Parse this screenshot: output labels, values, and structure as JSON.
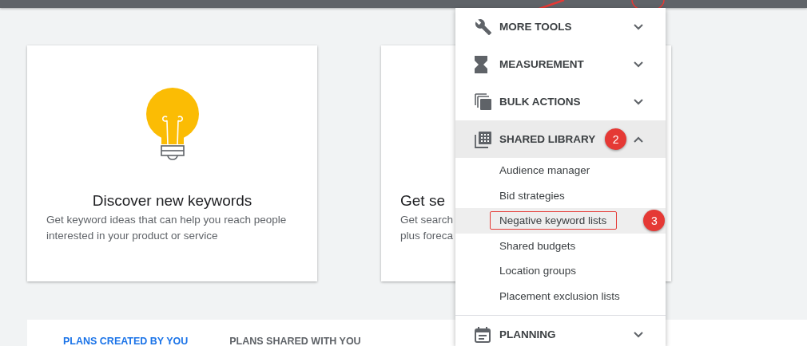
{
  "cards": [
    {
      "kind": "bulb",
      "title": "Discover new keywords",
      "description": [
        "Get keyword ideas that can help you reach people",
        "interested in your product or service"
      ]
    },
    {
      "kind": "plain",
      "title": "Get se",
      "description": [
        "Get search",
        "plus foreca"
      ]
    }
  ],
  "plan_tabs": [
    {
      "label": "PLANS CREATED BY YOU",
      "selected": true
    },
    {
      "label": "PLANS SHARED WITH YOU",
      "selected": false
    }
  ],
  "menu": {
    "sections": [
      {
        "kind": "wrench",
        "label": "MORE TOOLS",
        "expanded": false
      },
      {
        "kind": "hourglass",
        "label": "MEASUREMENT",
        "expanded": false
      },
      {
        "kind": "copies",
        "label": "BULK ACTIONS",
        "expanded": false
      },
      {
        "kind": "library",
        "label": "SHARED LIBRARY",
        "expanded": true,
        "step": "2",
        "items": [
          {
            "label": "Audience manager",
            "selected": false
          },
          {
            "label": "Bid strategies",
            "selected": false
          },
          {
            "label": "Negative keyword lists",
            "selected": true,
            "step": "3"
          },
          {
            "label": "Shared budgets",
            "selected": false
          },
          {
            "label": "Location groups",
            "selected": false
          },
          {
            "label": "Placement exclusion lists",
            "selected": false
          }
        ]
      },
      {
        "kind": "calendar",
        "label": "PLANNING",
        "expanded": false
      }
    ]
  }
}
